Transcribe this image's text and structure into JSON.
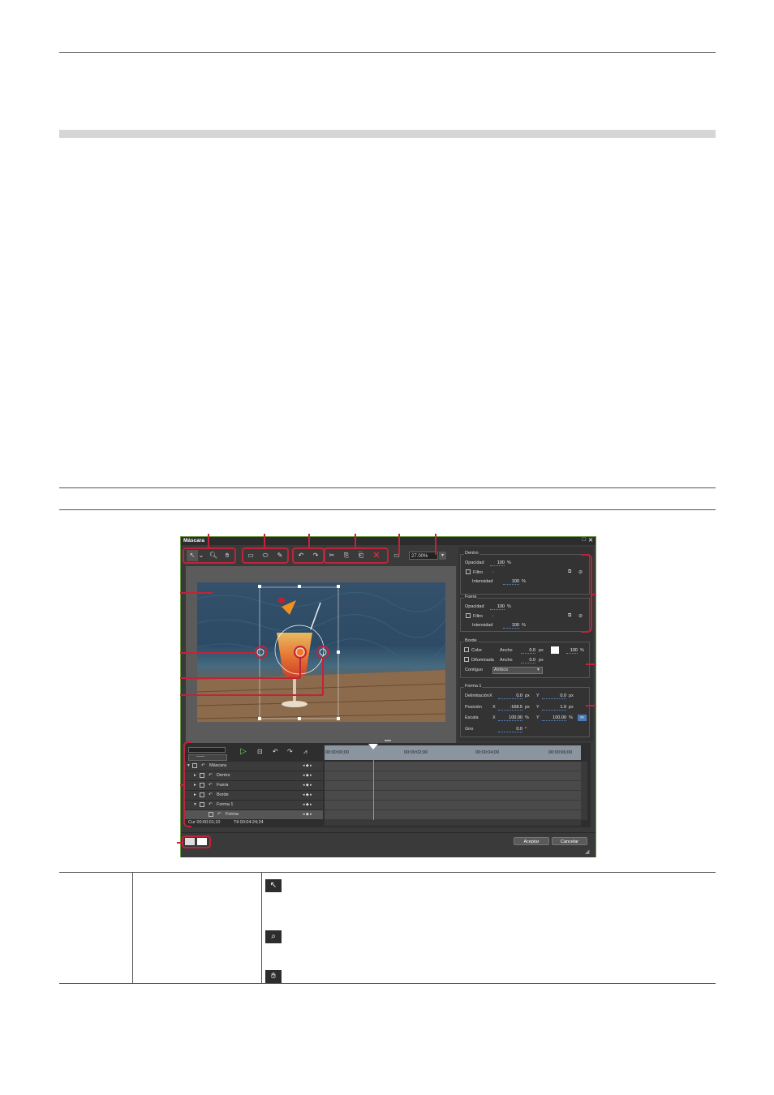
{
  "window": {
    "title": "Máscara",
    "controls": {
      "maximize": "□",
      "close": "✕"
    },
    "zoom": "27.00%"
  },
  "panel": {
    "dentro": {
      "title": "Dentro",
      "opacidad_label": "Opacidad",
      "opacidad_value": "100",
      "percent": "%",
      "filtro_label": "Filtro",
      "filtro_value": ":",
      "intensidad_label": "Intensidad",
      "intensidad_value": "100"
    },
    "fuera": {
      "title": "Fuera",
      "opacidad_label": "Opacidad",
      "opacidad_value": "100",
      "percent": "%",
      "filtro_label": "Filtro",
      "filtro_value": ":",
      "intensidad_label": "Intensidad",
      "intensidad_value": "100"
    },
    "borde": {
      "title": "Borde",
      "color_label": "Color",
      "ancho_label": "Ancho",
      "color_ancho": "0.0",
      "px": "px",
      "color_pct": "100",
      "percent": "%",
      "difuminada_label": "Difuminada",
      "dif_ancho": "0.0",
      "contiguo_label": "Contiguo",
      "contiguo_value": "Ambos"
    },
    "forma": {
      "title": "Forma 1",
      "delim_label": "DelimitaciónX",
      "delim_x": "0.0",
      "delim_y": "0.0",
      "pos_label": "Posición",
      "pos_x": "-168.5",
      "pos_y": "1.9",
      "escala_label": "Escala",
      "escala_x": "100.00",
      "escala_y": "100.00",
      "giro_label": "Giro",
      "giro": "0.0",
      "x": "X",
      "y": "Y",
      "px": "px",
      "percent": "%",
      "deg": "°"
    }
  },
  "timeline": {
    "tc_field": "-----",
    "ruler": [
      "00:00:00;00",
      "00:00:02;00",
      "00:00:04;00",
      "00:00:06;00"
    ],
    "tracks": [
      "Máscara",
      "Dentro",
      "Fuera",
      "Borde",
      "Forma 1",
      "Forma"
    ],
    "cur": "Cur 00:00:01;10",
    "ttl": "Ttl 00:04:24;24"
  },
  "buttons": {
    "accept": "Aceptar",
    "cancel": "Cancelar"
  }
}
